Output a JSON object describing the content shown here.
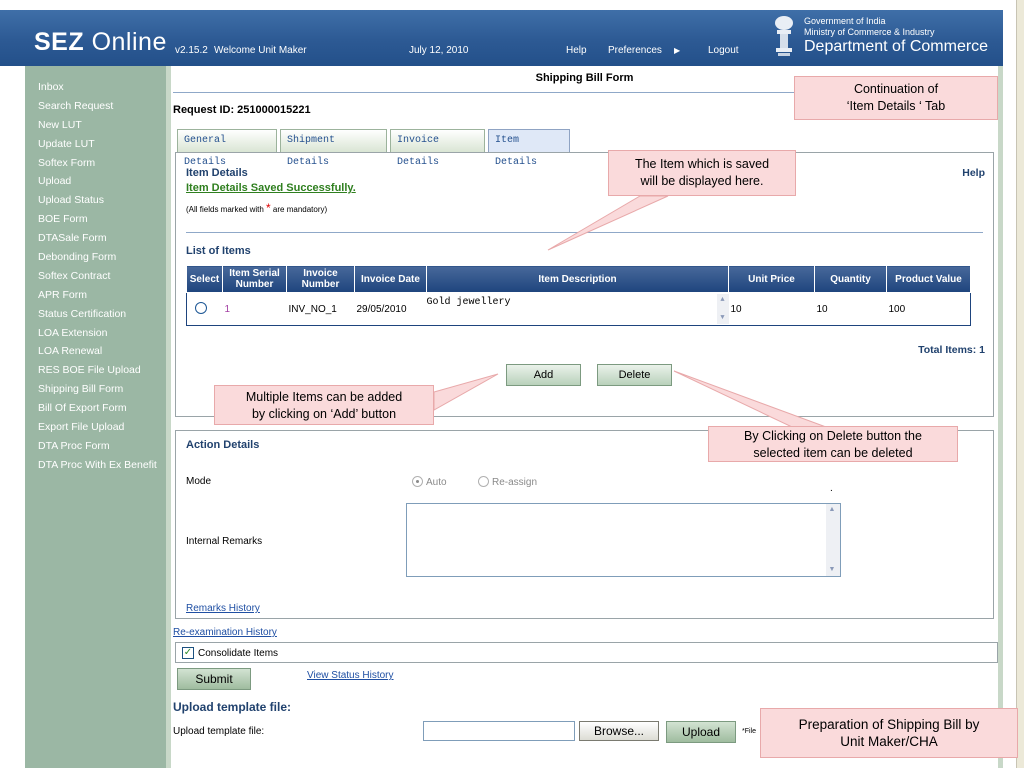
{
  "header": {
    "logo_bold": "SEZ",
    "logo_thin": "Online",
    "version": "v2.15.2",
    "welcome": "Welcome Unit Maker",
    "date": "July 12, 2010",
    "help": "Help",
    "preferences": "Preferences",
    "logout": "Logout",
    "govt_line1": "Government of India",
    "govt_line2": "Ministry of Commerce & Industry",
    "department": "Department of Commerce"
  },
  "sidebar": {
    "items": [
      "Inbox",
      "Search Request",
      "New LUT",
      "Update LUT",
      "Softex Form",
      "Upload",
      "Upload Status",
      "BOE Form",
      "DTASale Form",
      "Debonding Form",
      "Softex Contract",
      "APR Form",
      "Status Certification",
      "LOA Extension",
      "LOA Renewal",
      "RES BOE File Upload",
      "Shipping Bill Form",
      "Bill Of Export Form",
      "Export File Upload",
      "DTA Proc Form",
      "DTA Proc With Ex Benefit"
    ]
  },
  "form": {
    "title": "Shipping Bill Form",
    "request_id": "Request ID: 251000015221",
    "tabs": [
      "General Details",
      "Shipment Details",
      "Invoice Details",
      "Item Details"
    ],
    "item_details": {
      "heading": "Item Details",
      "saved_message": "Item Details Saved Successfully.",
      "mandatory_prefix": "(All fields marked with ",
      "mandatory_star": "*",
      "mandatory_suffix": " are mandatory)",
      "help": "Help",
      "list_title": "List of Items",
      "columns": [
        "Select",
        "Item Serial Number",
        "Invoice Number",
        "Invoice Date",
        "Item Description",
        "Unit Price",
        "Quantity",
        "Product Value"
      ],
      "rows": [
        {
          "serial": "1",
          "invoice_number": "INV_NO_1",
          "invoice_date": "29/05/2010",
          "description": "Gold jewellery",
          "unit_price": "10",
          "quantity": "10",
          "product_value": "100"
        }
      ],
      "total_items": "Total Items: 1",
      "add_label": "Add",
      "delete_label": "Delete"
    },
    "action_details": {
      "heading": "Action Details",
      "mode_label": "Mode",
      "mode_auto": "Auto",
      "mode_reassign": "Re-assign",
      "dot": ".",
      "internal_remarks_label": "Internal Remarks",
      "remarks_history": "Remarks History"
    },
    "reexamination_history": "Re-examination History",
    "consolidate_label": "Consolidate Items",
    "submit_label": "Submit",
    "view_status_history": "View Status History",
    "upload": {
      "title": "Upload template file:",
      "label": "Upload template file:",
      "browse_label": "Browse...",
      "upload_label": "Upload",
      "note": "*File"
    }
  },
  "callouts": {
    "continuation": [
      "Continuation of",
      "‘Item Details ‘ Tab"
    ],
    "saved": [
      "The Item which is saved",
      "will be displayed here."
    ],
    "multiple": [
      "Multiple Items can be added",
      "by clicking on ‘Add’ button"
    ],
    "delete": [
      "By Clicking on Delete button the",
      "selected item can be deleted"
    ],
    "preparation": [
      "Preparation of Shipping Bill by",
      "Unit Maker/CHA"
    ]
  },
  "colors": {
    "header_blue": "#2d5a94",
    "sidebar_green": "#9bb7a4",
    "table_header": "#1e447d",
    "callout_pink": "#fadadb",
    "success_green": "#2f7f1f"
  }
}
